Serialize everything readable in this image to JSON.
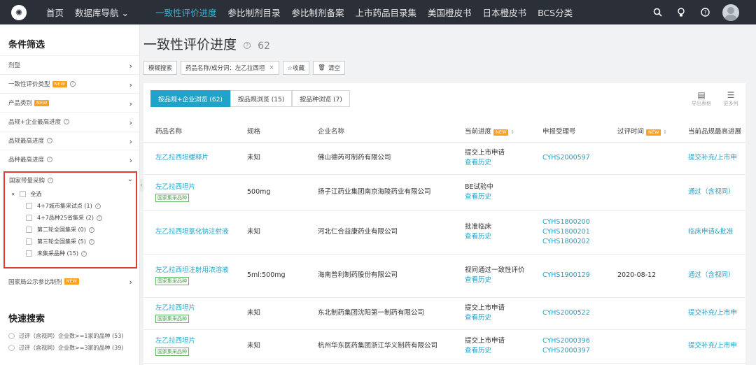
{
  "nav": {
    "items": [
      {
        "label": "首页",
        "active": false
      },
      {
        "label": "数据库导航 ⌄",
        "active": false
      },
      {
        "label": "一致性评价进度",
        "active": true
      },
      {
        "label": "参比制剂目录",
        "active": false
      },
      {
        "label": "参比制剂备案",
        "active": false
      },
      {
        "label": "上市药品目录集",
        "active": false
      },
      {
        "label": "美国橙皮书",
        "active": false
      },
      {
        "label": "日本橙皮书",
        "active": false
      },
      {
        "label": "BCS分类",
        "active": false
      }
    ],
    "icons": [
      "search-icon",
      "bulb-icon",
      "help-icon",
      "user-avatar"
    ]
  },
  "sidebar": {
    "title": "条件筛选",
    "new_badge": "NEW",
    "rows": [
      {
        "label": "剂型",
        "new": false,
        "help": false
      },
      {
        "label": "一致性评价类型",
        "new": true,
        "help": true
      },
      {
        "label": "产品类别",
        "new": true,
        "help": false
      },
      {
        "label": "品规+企业最高进度",
        "new": false,
        "help": true
      },
      {
        "label": "品规最高进度",
        "new": false,
        "help": true
      },
      {
        "label": "品种最高进度",
        "new": false,
        "help": true
      }
    ],
    "purchase": {
      "label": "国家带量采购",
      "tree": [
        {
          "label": "全选",
          "indent": 0
        },
        {
          "label": "4+7城市集采试点 (1)",
          "indent": 1
        },
        {
          "label": "4+7品种25省集采 (2)",
          "indent": 1
        },
        {
          "label": "第二轮全国集采 (0)",
          "indent": 1
        },
        {
          "label": "第三轮全国集采 (5)",
          "indent": 1
        },
        {
          "label": "未集采品种 (15)",
          "indent": 1
        }
      ]
    },
    "after_row": {
      "label": "国家局公示参比制剂",
      "new": true
    },
    "quick_search": {
      "title": "快速搜索",
      "options": [
        "过评（含视同）企业数>=1家的品种 (53)",
        "过评（含视同）企业数>=3家的品种 (39)"
      ]
    }
  },
  "main": {
    "title": "一致性评价进度",
    "count": "62",
    "filters": {
      "fuzzy": "模糊搜索",
      "chip": "药品名称/成分词：左乙拉西坦",
      "favorite": "☆收藏",
      "clear": "清空"
    },
    "tabs": [
      "按品规+企业浏览 (62)",
      "按品规浏览 (15)",
      "按品种浏览 (7)"
    ],
    "tools": {
      "export": "导出表格",
      "more": "更多列"
    },
    "columns": [
      "药品名称",
      "规格",
      "企业名称",
      "当前进度",
      "申报受理号",
      "过评时间",
      "当前品规最高进展"
    ],
    "rows": [
      {
        "drug": "左乙拉西坦缓释片",
        "tag": "",
        "spec": "未知",
        "company": "佛山德芮可制药有限公司",
        "progress": "提交上市申请",
        "history": "查看历史",
        "accept": [
          "CYHS2000597"
        ],
        "date": "",
        "highest": "提交补充/上市申"
      },
      {
        "drug": "左乙拉西坦片",
        "tag": "国家集采品种",
        "spec": "500mg",
        "company": "扬子江药业集团南京海陵药业有限公司",
        "progress": "BE试验中",
        "history": "查看历史",
        "accept": [],
        "date": "",
        "highest": "通过（含视同）"
      },
      {
        "drug": "左乙拉西坦氯化钠注射液",
        "tag": "",
        "spec": "未知",
        "company": "河北仁合益康药业有限公司",
        "progress": "批准临床",
        "history": "查看历史",
        "accept": [
          "CYHS1800200",
          "CYHS1800201",
          "CYHS1800202"
        ],
        "date": "",
        "highest": "临床申请&批准"
      },
      {
        "drug": "左乙拉西坦注射用浓溶液",
        "tag": "国家集采品种",
        "spec": "5ml:500mg",
        "company": "海南普利制药股份有限公司",
        "progress": "视同通过一致性评价",
        "history": "查看历史",
        "accept": [
          "CYHS1900129"
        ],
        "date": "2020-08-12",
        "highest": "通过（含视同）"
      },
      {
        "drug": "左乙拉西坦片",
        "tag": "国家集采品种",
        "spec": "未知",
        "company": "东北制药集团沈阳第一制药有限公司",
        "progress": "提交上市申请",
        "history": "查看历史",
        "accept": [
          "CYHS2000522"
        ],
        "date": "",
        "highest": "提交补充/上市申"
      },
      {
        "drug": "左乙拉西坦片",
        "tag": "国家集采品种",
        "spec": "未知",
        "company": "杭州华东医药集团浙江华义制药有限公司",
        "progress": "提交上市申请",
        "history": "查看历史",
        "accept": [
          "CYHS2000396",
          "CYHS2000397"
        ],
        "date": "",
        "highest": "提交补充/上市申"
      }
    ]
  },
  "colors": {
    "accent": "#1fa3c9",
    "nav_bg": "#2b2f38",
    "highlight_box": "#e33a35",
    "new_badge": "#ff9f1a",
    "tag_green": "#4a9f4a"
  }
}
